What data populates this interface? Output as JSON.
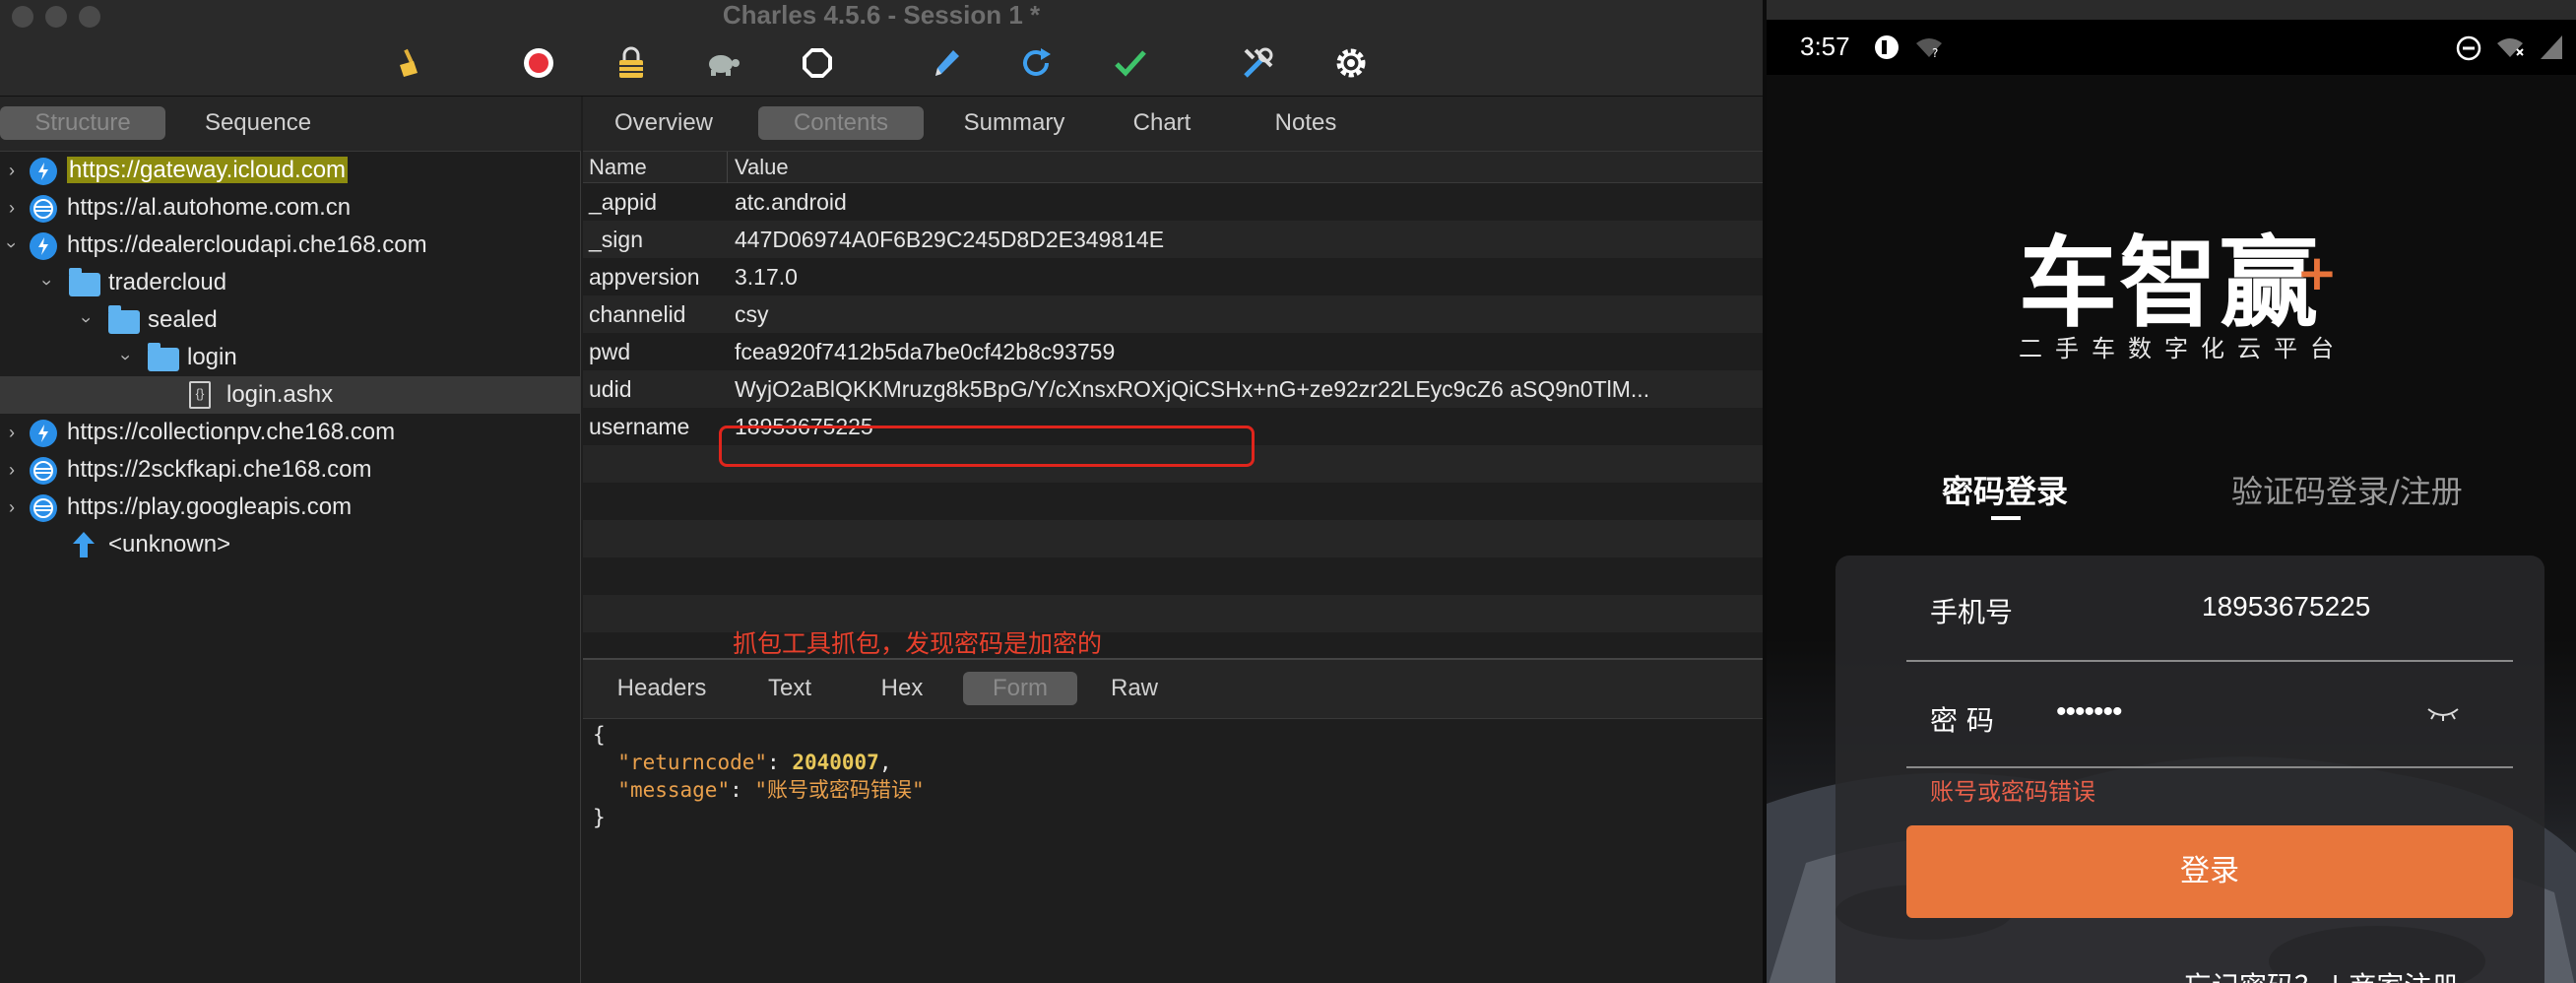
{
  "charles": {
    "window_title": "Charles 4.5.6 - Session 1 *",
    "toolbar_icons": [
      "broom-icon",
      "record-icon",
      "lock-icon",
      "turtle-icon",
      "stop-icon",
      "pen-icon",
      "refresh-icon",
      "check-icon",
      "tools-icon",
      "gear-icon"
    ],
    "left_tabs": {
      "structure": "Structure",
      "sequence": "Sequence"
    },
    "tree": [
      {
        "label": "https://gateway.icloud.com",
        "type": "host"
      },
      {
        "label": "https://al.autohome.com.cn",
        "type": "host"
      },
      {
        "label": "https://dealercloudapi.che168.com",
        "type": "host"
      },
      {
        "label": "tradercloud",
        "type": "folder"
      },
      {
        "label": "sealed",
        "type": "folder"
      },
      {
        "label": "login",
        "type": "folder"
      },
      {
        "label": "login.ashx",
        "type": "file"
      },
      {
        "label": "https://collectionpv.che168.com",
        "type": "host"
      },
      {
        "label": "https://2sckfkapi.che168.com",
        "type": "host"
      },
      {
        "label": "https://play.googleapis.com",
        "type": "host"
      },
      {
        "label": "<unknown>",
        "type": "unknown"
      }
    ],
    "right_tabs": {
      "overview": "Overview",
      "contents": "Contents",
      "summary": "Summary",
      "chart": "Chart",
      "notes": "Notes"
    },
    "kv_header": {
      "name": "Name",
      "value": "Value"
    },
    "params": [
      {
        "name": "_appid",
        "value": "atc.android"
      },
      {
        "name": "_sign",
        "value": "447D06974A0F6B29C245D8D2E349814E"
      },
      {
        "name": "appversion",
        "value": "3.17.0"
      },
      {
        "name": "channelid",
        "value": "csy"
      },
      {
        "name": "pwd",
        "value": "fcea920f7412b5da7be0cf42b8c93759"
      },
      {
        "name": "udid",
        "value": "WyjO2aBlQKKMruzg8k5BpG/Y/cXnsxROXjQiCSHx+nG+ze92zr22LEyc9cZ6 aSQ9n0TlM..."
      },
      {
        "name": "username",
        "value": "18953675225"
      }
    ],
    "annotation": "抓包工具抓包，发现密码是加密的",
    "bottom_tabs": {
      "headers": "Headers",
      "text": "Text",
      "hex": "Hex",
      "form": "Form",
      "raw": "Raw"
    },
    "response": {
      "open": "{",
      "k1": "\"returncode\"",
      "v1": "2040007",
      "k2": "\"message\"",
      "v2": "\"账号或密码错误\"",
      "close": "}"
    }
  },
  "phone": {
    "time": "3:57",
    "logo": "车智赢",
    "logo_plus": "+",
    "slogan": "二手车数字化云平台",
    "tab_password": "密码登录",
    "tab_sms": "验证码登录/注册",
    "phone_label": "手机号",
    "phone_value": "18953675225",
    "password_label": "密 码",
    "password_value": "•••••••",
    "error": "账号或密码错误",
    "login_button": "登录",
    "forgot": "忘记密码？  |  商家注册"
  },
  "colors": {
    "highlight": "#8d8c0f",
    "annotation_red": "#e0251c",
    "login_orange": "#e8763c",
    "host_icon_blue": "#2a8fe8"
  }
}
